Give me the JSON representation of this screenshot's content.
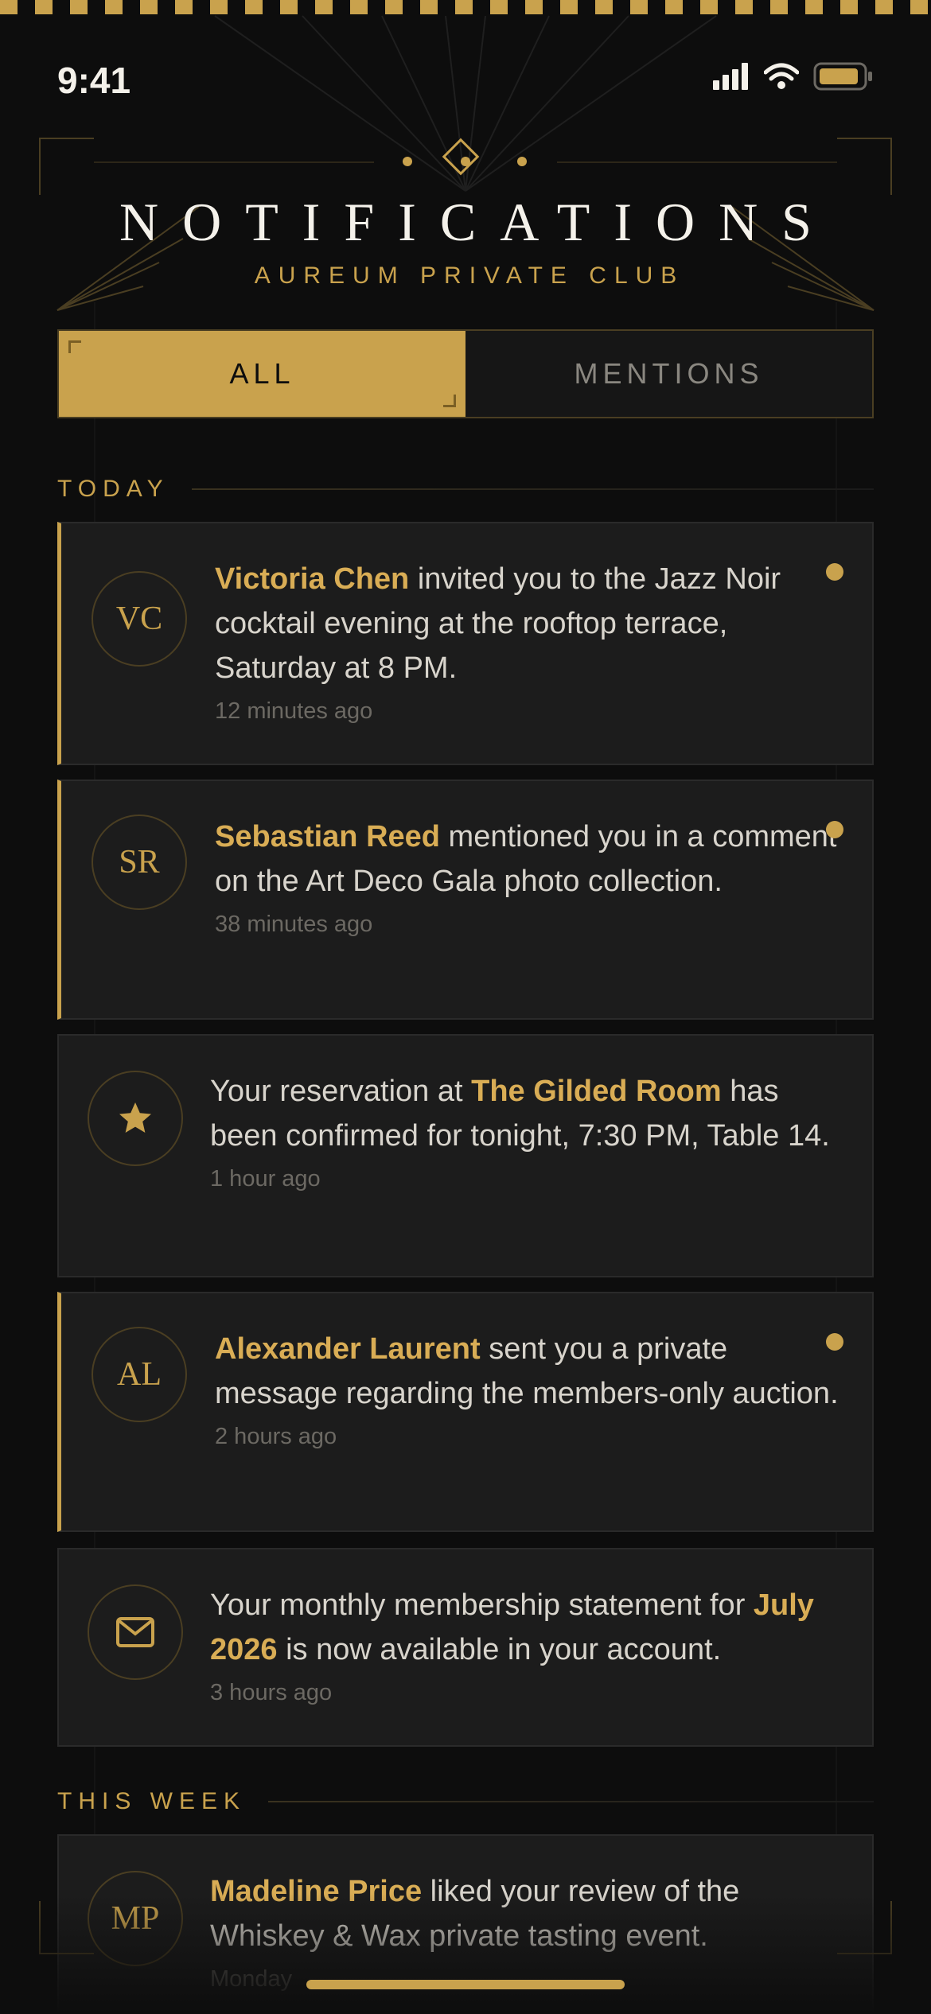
{
  "status": {
    "time": "9:41"
  },
  "header": {
    "title": "NOTIFICATIONS",
    "subtitle": "AUREUM PRIVATE CLUB"
  },
  "tabs": [
    {
      "label": "ALL",
      "active": true
    },
    {
      "label": "MENTIONS",
      "active": false
    }
  ],
  "sections": {
    "today": "TODAY",
    "this_week": "THIS WEEK"
  },
  "notifications": [
    {
      "initials": "VC",
      "highlight": "Victoria Chen",
      "text": " invited you to the Jazz Noir cocktail evening at the rooftop terrace, Saturday at 8 PM.",
      "time": "12 minutes ago",
      "unread": true
    },
    {
      "initials": "SR",
      "highlight": "Sebastian Reed",
      "text": " mentioned you in a comment on the Art Deco Gala photo collection.",
      "time": "38 minutes ago",
      "unread": true
    },
    {
      "icon": "star-icon",
      "pre": "Your reservation at ",
      "highlight": "The Gilded Room",
      "text": " has been confirmed for tonight, 7:30 PM, Table 14.",
      "time": "1 hour ago",
      "unread": false
    },
    {
      "initials": "AL",
      "highlight": "Alexander Laurent",
      "text": " sent you a private message regarding the members-only auction.",
      "time": "2 hours ago",
      "unread": true
    },
    {
      "icon": "envelope-icon",
      "pre": "Your monthly membership statement for ",
      "highlight": "July 2026",
      "text": " is now available in your account.",
      "time": "3 hours ago",
      "unread": false
    },
    {
      "initials": "MP",
      "highlight": "Madeline Price",
      "text": " liked your review of the Whiskey & Wax private tasting event.",
      "time": "Monday",
      "unread": false
    }
  ],
  "colors": {
    "accent": "#c9a24d",
    "background": "#0d0d0d",
    "card": "#1c1c1c"
  }
}
